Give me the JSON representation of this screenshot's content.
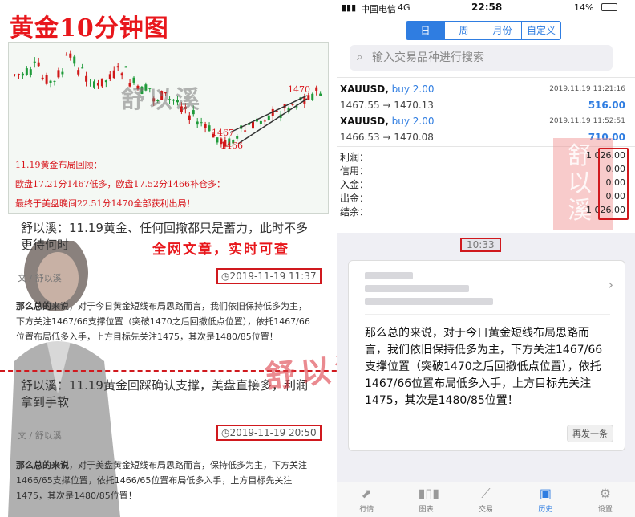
{
  "left": {
    "title": "黄金10分钟图",
    "chart": {
      "label_1470": "1470",
      "label_1467": "1467",
      "label_1466": "1466",
      "watermark": "舒以溪",
      "notes": [
        "11.19黄金布局回顾：",
        "欧盘17.21分1467低多，欧盘17.52分1466补仓多：",
        "最终于美盘晚间22.51分1470全部获利出局！"
      ]
    },
    "post1": {
      "title": "舒以溪：11.19黄金、任何回撤都只是蓄力，此时不多更待何时",
      "slogan": "全网文章，实时可查",
      "meta": "文 / 舒以溪",
      "date": "2019-11-19 11:37",
      "body_bold": "那么总的",
      "body": "来说，对于今日黄金短线布局思路而言，我们依旧保持低多为主，下方关注1467/66支撑位置（突破1470之后回撤低点位置），依托1467/66位置布局低多入手，上方目标先关注1475，其次是1480/85位置！"
    },
    "watermark2": "舒以溪",
    "post2": {
      "title": "舒以溪：11.19黄金回踩确认支撑，美盘直接多，利润拿到手软",
      "meta": "文 / 舒以溪",
      "date": "2019-11-19 20:50",
      "body_bold": "那么总的来说",
      "body": "，对于美盘黄金短线布局思路而言，保持低多为主，下方关注1466/65支撑位置，依托1466/65位置布局低多入手，上方目标先关注1475，其次是1480/85位置！"
    }
  },
  "status": {
    "carrier": "中国电信",
    "network": "4G",
    "time": "22:58",
    "battery": "14%"
  },
  "segments": [
    "日",
    "周",
    "月份",
    "自定义"
  ],
  "search": {
    "placeholder": "输入交易品种进行搜索"
  },
  "trades": [
    {
      "symbol": "XAUUSD,",
      "side": "buy 2.00",
      "date": "2019.11.19 11:21:16",
      "prices": "1467.55 → 1470.13",
      "profit": "516.00"
    },
    {
      "symbol": "XAUUSD,",
      "side": "buy 2.00",
      "date": "2019.11.19 11:52:51",
      "prices": "1466.53 → 1470.08",
      "profit": "710.00"
    }
  ],
  "summary": [
    {
      "label": "利润：",
      "value": "1 026.00"
    },
    {
      "label": "信用：",
      "value": "0.00"
    },
    {
      "label": "入金：",
      "value": "0.00"
    },
    {
      "label": "出金：",
      "value": "0.00"
    },
    {
      "label": "结余：",
      "value": "1 026.00"
    }
  ],
  "stamp": "舒以溪",
  "message": {
    "time": "10:33",
    "text": "那么总的来说，对于今日黄金短线布局思路而言，我们依旧保持低多为主，下方关注1467/66支撑位置（突破1470之后回撤低点位置），依托1467/66位置布局低多入手，上方目标先关注1475，其次是1480/85位置！",
    "more": "再发一条"
  },
  "tabs": [
    {
      "label": "行情",
      "icon": "trend-arrow-icon"
    },
    {
      "label": "图表",
      "icon": "candlestick-icon"
    },
    {
      "label": "交易",
      "icon": "trade-line-icon"
    },
    {
      "label": "历史",
      "icon": "inbox-icon"
    },
    {
      "label": "设置",
      "icon": "gear-icon"
    }
  ],
  "colors": {
    "accent": "#2f7de1",
    "highlight": "#d0191e",
    "title": "#e8171c"
  }
}
